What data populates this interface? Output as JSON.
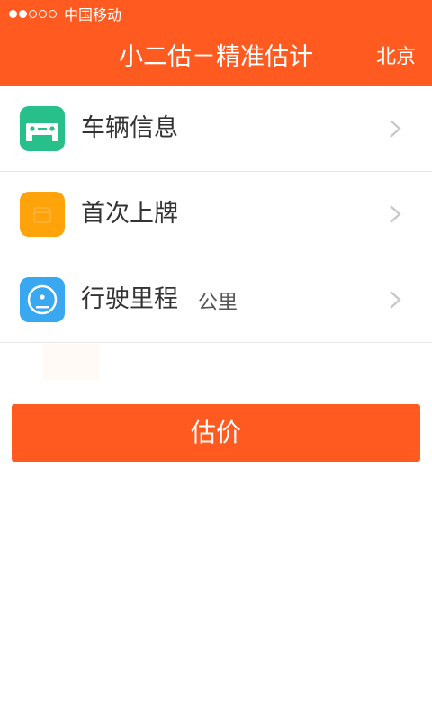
{
  "status_bar": {
    "carrier": "中国移动",
    "signal_bars_filled": 2,
    "signal_bars_total": 5
  },
  "header": {
    "title": "小二估－精准估计",
    "city": "北京"
  },
  "rows": [
    {
      "label": "车辆信息",
      "unit": "",
      "icon": "car-icon",
      "icon_color": "#27c08b"
    },
    {
      "label": "首次上牌",
      "unit": "",
      "icon": "calendar-icon",
      "icon_color": "#ffa30a"
    },
    {
      "label": "行驶里程",
      "unit": "公里",
      "icon": "speedometer-icon",
      "icon_color": "#3aa8f0"
    }
  ],
  "button": {
    "label": "估价"
  },
  "colors": {
    "brand": "#ff5a1f",
    "divider": "#e6e6e6",
    "chevron": "#c7c7c7"
  }
}
